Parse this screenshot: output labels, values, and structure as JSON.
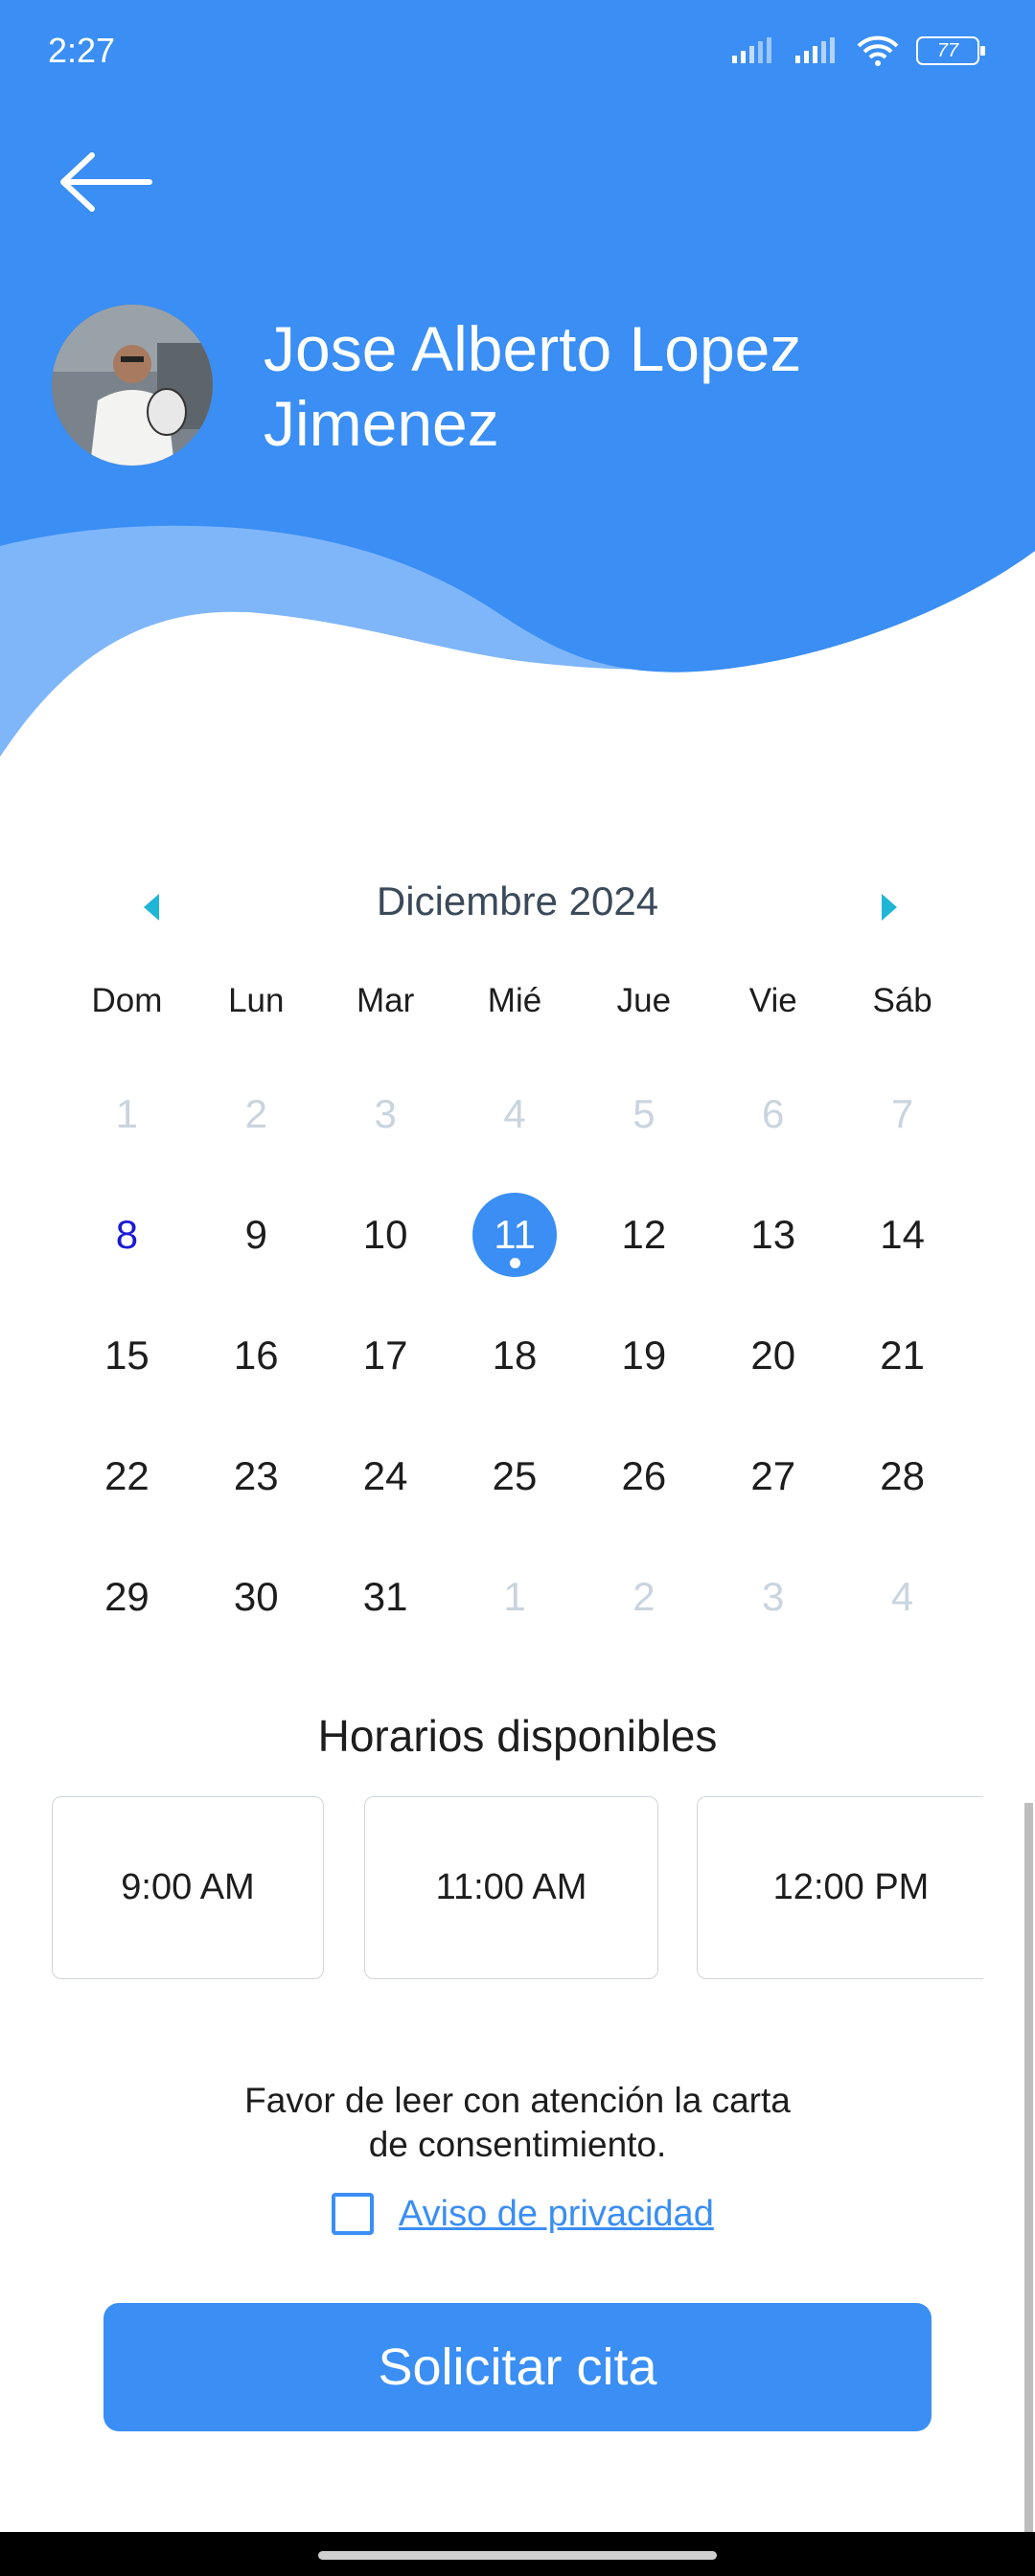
{
  "status_bar": {
    "time": "2:27",
    "battery": "77"
  },
  "header": {
    "doctor_name": "Jose Alberto Lopez Jimenez"
  },
  "calendar": {
    "month_title": "Diciembre 2024",
    "weekdays": [
      "Dom",
      "Lun",
      "Mar",
      "Mié",
      "Jue",
      "Vie",
      "Sáb"
    ],
    "weeks": [
      [
        "1",
        "2",
        "3",
        "4",
        "5",
        "6",
        "7"
      ],
      [
        "8",
        "9",
        "10",
        "11",
        "12",
        "13",
        "14"
      ],
      [
        "15",
        "16",
        "17",
        "18",
        "19",
        "20",
        "21"
      ],
      [
        "22",
        "23",
        "24",
        "25",
        "26",
        "27",
        "28"
      ],
      [
        "29",
        "30",
        "31",
        "1",
        "2",
        "3",
        "4"
      ]
    ]
  },
  "schedule": {
    "title": "Horarios disponibles",
    "slots": [
      "9:00 AM",
      "11:00 AM",
      "12:00 PM"
    ]
  },
  "consent": {
    "line1": "Favor de leer con atención la carta",
    "line2": "de consentimiento.",
    "privacy_link": "Aviso de privacidad"
  },
  "submit_label": "Solicitar cita",
  "colors": {
    "primary": "#3a8ef4",
    "wave_light": "#7fb6fa",
    "today": "#1a1ad6"
  }
}
